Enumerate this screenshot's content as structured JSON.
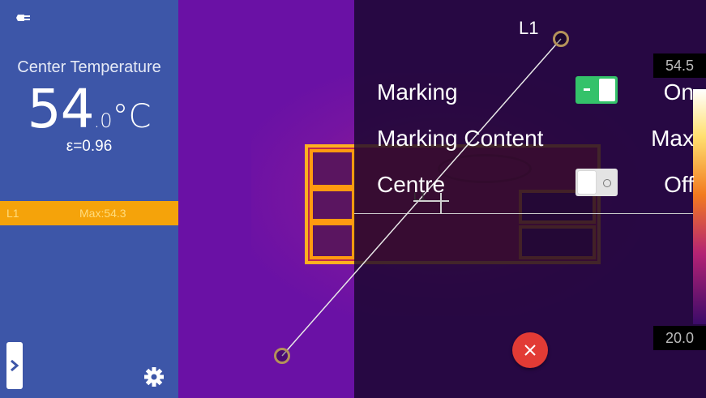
{
  "sidebar": {
    "icon_power": "plug-icon",
    "title": "Center Temperature",
    "temp_integer": "54",
    "temp_decimal": ".0",
    "temp_unit": "°C",
    "emissivity": "ε=0.96",
    "measure_bar": {
      "line_name": "L1",
      "max_text": "Max:54.3"
    },
    "expand_icon": "chevron-right-icon",
    "settings_icon": "gear-icon"
  },
  "thermal": {
    "line_label": "L1",
    "scale_max": "54.5",
    "scale_min": "20.0",
    "cursor_label": "L1"
  },
  "settings": {
    "rows": [
      {
        "label": "Marking",
        "value": "On",
        "toggle": true
      },
      {
        "label": "Marking Content",
        "value": "Max"
      },
      {
        "label": "Centre",
        "value": "Off",
        "toggle": false
      }
    ],
    "close_icon": "close-icon"
  },
  "colors": {
    "sidebar": "#3d56a8",
    "measure_bar": "#f5a30a",
    "toggle_on": "#34c26a",
    "close_button": "#e23b35"
  }
}
